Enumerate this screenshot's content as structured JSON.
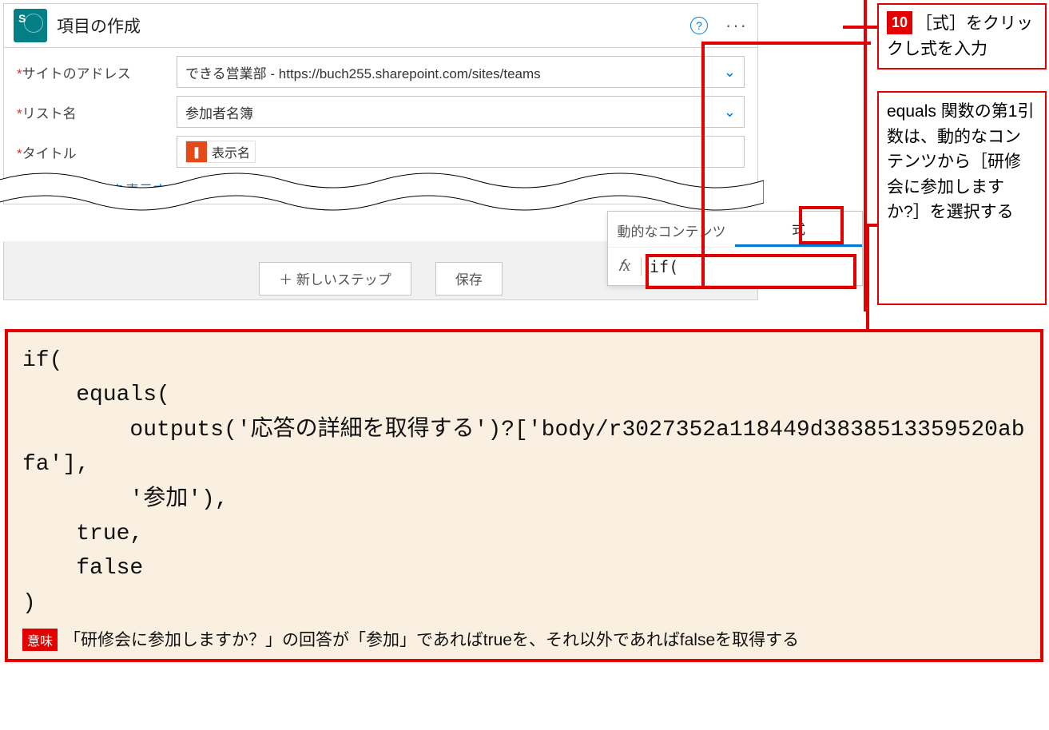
{
  "card": {
    "title": "項目の作成",
    "fields": {
      "siteAddress": {
        "label": "サイトのアドレス",
        "value": "できる営業部 - https://buch255.sharepoint.com/sites/teams"
      },
      "listName": {
        "label": "リスト名",
        "value": "参加者名簿"
      },
      "titleField": {
        "label": "タイトル",
        "tokenLabel": "表示名"
      }
    },
    "advancedLink": "詳細オプションを表示する",
    "buttons": {
      "newStep": "＋ 新しいステップ",
      "save": "保存"
    }
  },
  "expressionPopup": {
    "tabDynamic": "動的なコンテンツ",
    "tabExpression": "式",
    "fxLabel": "𝑓x",
    "inputValue": "if("
  },
  "annotations": {
    "stepNumber": "10",
    "stepText": "［式］をクリックし式を入力",
    "explain": "equals 関数の第1引数は、動的なコンテンツから［研修会に参加しますか?］を選択する"
  },
  "code": {
    "text": "if(\n    equals(\n        outputs('応答の詳細を取得する')?['body/r3027352a118449d3838513359520abfa'],\n        '参加'),\n    true,\n    false\n)",
    "meaningLabel": "意味",
    "meaningText": "「研修会に参加しますか？」の回答が「参加」であればtrueを、それ以外であればfalseを取得する"
  }
}
